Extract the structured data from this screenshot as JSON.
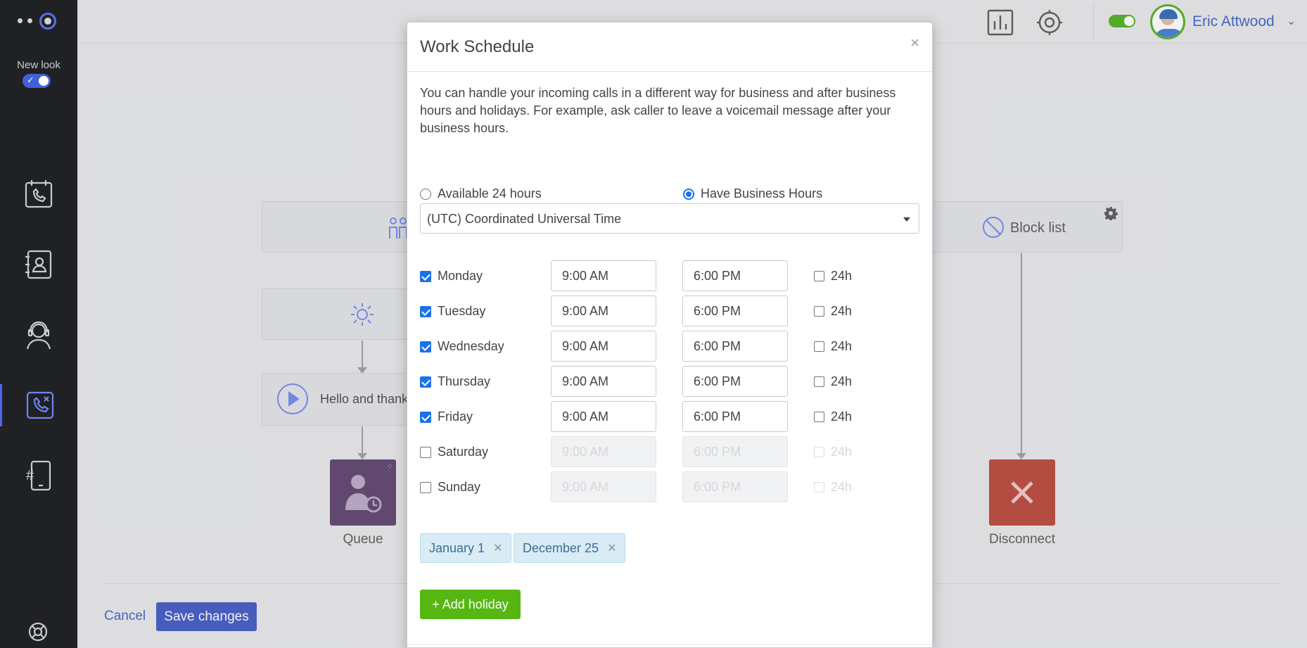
{
  "sidebar": {
    "new_look_label": "New look"
  },
  "header": {
    "user_name": "Eric Attwood"
  },
  "canvas": {
    "block_list_label": "Block list",
    "greeting_label": "Hello and thank",
    "queue_label": "Queue",
    "disconnect_label": "Disconnect",
    "cancel_label": "Cancel",
    "save_label": "Save changes"
  },
  "modal": {
    "title": "Work Schedule",
    "close_glyph": "×",
    "intro": "You can handle your incoming calls in a different way for business and after business hours and holidays. For example, ask caller to leave a voicemail message after your business hours.",
    "option_24h": "Available 24 hours",
    "option_business": "Have Business Hours",
    "selected_option": "business",
    "timezone": "(UTC) Coordinated Universal Time",
    "h24_label": "24h",
    "days": [
      {
        "name": "Monday",
        "enabled": true,
        "start": "9:00 AM",
        "end": "6:00 PM",
        "all_day": false
      },
      {
        "name": "Tuesday",
        "enabled": true,
        "start": "9:00 AM",
        "end": "6:00 PM",
        "all_day": false
      },
      {
        "name": "Wednesday",
        "enabled": true,
        "start": "9:00 AM",
        "end": "6:00 PM",
        "all_day": false
      },
      {
        "name": "Thursday",
        "enabled": true,
        "start": "9:00 AM",
        "end": "6:00 PM",
        "all_day": false
      },
      {
        "name": "Friday",
        "enabled": true,
        "start": "9:00 AM",
        "end": "6:00 PM",
        "all_day": false
      },
      {
        "name": "Saturday",
        "enabled": false,
        "start": "9:00 AM",
        "end": "6:00 PM",
        "all_day": false
      },
      {
        "name": "Sunday",
        "enabled": false,
        "start": "9:00 AM",
        "end": "6:00 PM",
        "all_day": false
      }
    ],
    "holidays": [
      "January 1",
      "December 25"
    ],
    "tag_remove_glyph": "✕",
    "add_holiday_label": "+ Add holiday"
  },
  "colors": {
    "sidebar_bg": "#202124",
    "accent_blue": "#3d55c2",
    "checkbox_blue": "#1a73e8",
    "add_green": "#56b713",
    "queue_purple": "#5a3e68",
    "disconnect_red": "#b84235"
  },
  "icons": [
    "calls-icon",
    "contacts-icon",
    "agent-icon",
    "call-flow-icon",
    "numbers-icon",
    "help-icon",
    "stats-icon",
    "settings-icon",
    "people-icon",
    "sun-icon",
    "play-icon",
    "block-icon",
    "gear-icon",
    "queue-icon",
    "close-icon"
  ]
}
